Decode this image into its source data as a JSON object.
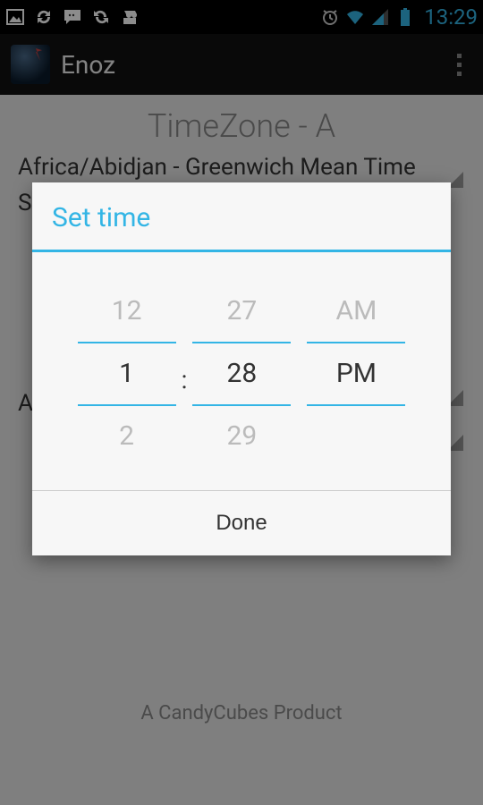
{
  "status": {
    "time": "13:29"
  },
  "actionbar": {
    "title": "Enoz"
  },
  "page": {
    "title": "TimeZone - A",
    "tz_line": "Africa/Abidjan - Greenwich Mean Time",
    "cut_s": "S",
    "cut_a": "A",
    "footer": "A CandyCubes Product"
  },
  "dialog": {
    "title": "Set time",
    "hour": {
      "prev": "12",
      "sel": "1",
      "next": "2"
    },
    "minute": {
      "prev": "27",
      "sel": "28",
      "next": "29"
    },
    "ampm": {
      "prev": "AM",
      "sel": "PM",
      "next": ""
    },
    "done": "Done",
    "colon": ":"
  }
}
